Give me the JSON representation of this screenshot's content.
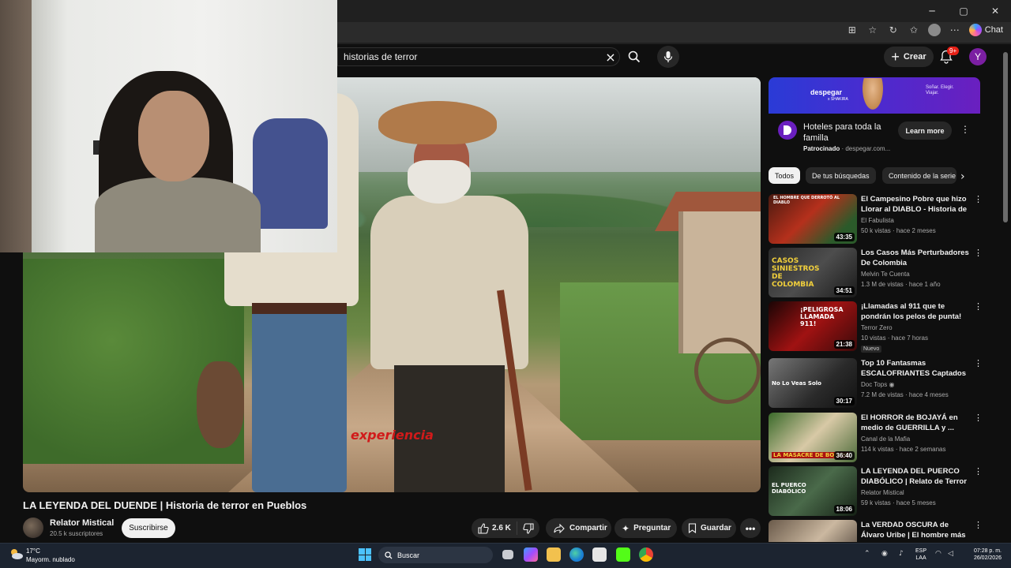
{
  "browser": {
    "window_controls": {
      "minimize": "─",
      "maximize": "▢",
      "close": "✕"
    },
    "copilot_label": "Chat"
  },
  "youtube": {
    "search": {
      "value": "historias de terror"
    },
    "header": {
      "create_label": "Crear",
      "notifications_count": "9+",
      "avatar_letter": "Y"
    }
  },
  "player": {
    "overlay_word": "experiencia"
  },
  "video": {
    "title": "LA LEYENDA DEL DUENDE | Historia de terror en Pueblos",
    "channel": "Relator Mistical",
    "subscribers": "20.5 k suscriptores",
    "subscribe_label": "Suscribirse",
    "likes": "2.6 K",
    "share_label": "Compartir",
    "ask_label": "Preguntar",
    "save_label": "Guardar"
  },
  "ad": {
    "brand": "despegar",
    "brand_sub": "x SHAKIRA",
    "tagline": "Soñar. Elegir. Viajar.",
    "title": "Hoteles para toda la familla",
    "sponsored": "Patrocinado",
    "domain": "despegar.com...",
    "cta": "Learn more"
  },
  "chips": [
    "Todos",
    "De tus búsquedas",
    "Contenido de la serie"
  ],
  "recommendations": [
    {
      "title": "El Campesino Pobre que hizo Llorar al DIABLO - Historia de ...",
      "channel": "El Fabulista",
      "views": "50 k vistas",
      "age": "hace 2 meses",
      "duration": "43:35",
      "thumb_text": "EL HOMBRE QUE DERROTÓ AL DIABLO",
      "new": ""
    },
    {
      "title": "Los Casos Más Perturbadores De Colombia",
      "channel": "Melvin Te Cuenta",
      "views": "1.3 M de vistas",
      "age": "hace 1 año",
      "duration": "34:51",
      "thumb_text": "CASOS SINIESTROS DE COLOMBIA",
      "new": ""
    },
    {
      "title": "¡Llamadas al 911 que te pondrán los pelos de punta!",
      "channel": "Terror Zero",
      "views": "10 vistas",
      "age": "hace 7 horas",
      "duration": "21:38",
      "thumb_text": "¡PELIGROSA LLAMADA 911!",
      "new": "Nuevo"
    },
    {
      "title": "Top 10 Fantasmas ESCALOFRIANTES Captados E...",
      "channel": "Doc Tops",
      "views": "7.2 M de vistas",
      "age": "hace 4 meses",
      "duration": "30:17",
      "thumb_text": "No Lo Veas Solo",
      "new": ""
    },
    {
      "title": "El HORROR de BOJAYÁ en medio de GUERRILLA y ...",
      "channel": "Canal de la Mafia",
      "views": "114 k vistas",
      "age": "hace 2 semanas",
      "duration": "36:40",
      "thumb_text": "LA MASACRE DE BOJAYÁ",
      "new": ""
    },
    {
      "title": "LA LEYENDA DEL PUERCO DIABÓLICO | Relato de Terror ...",
      "channel": "Relator Mistical",
      "views": "59 k vistas",
      "age": "hace 5 meses",
      "duration": "18:06",
      "thumb_text": "EL PUERCO DIABÓLICO",
      "new": ""
    },
    {
      "title": "La VERDAD OSCURA de Álvaro Uribe | El hombre más poderos...",
      "channel": "",
      "views": "",
      "age": "",
      "duration": "",
      "thumb_text": "",
      "new": ""
    }
  ],
  "taskbar": {
    "temperature": "17°C",
    "weather": "Mayorm. nublado",
    "search_label": "Buscar",
    "lang_1": "ESP",
    "lang_2": "LAA",
    "time": "07:28 p. m.",
    "date": "26/02/2026"
  },
  "colors": {
    "yt_bg": "#0f0f0f",
    "chip_bg": "#272727",
    "accent_red": "#e62117",
    "taskbar": "#1c2430"
  }
}
